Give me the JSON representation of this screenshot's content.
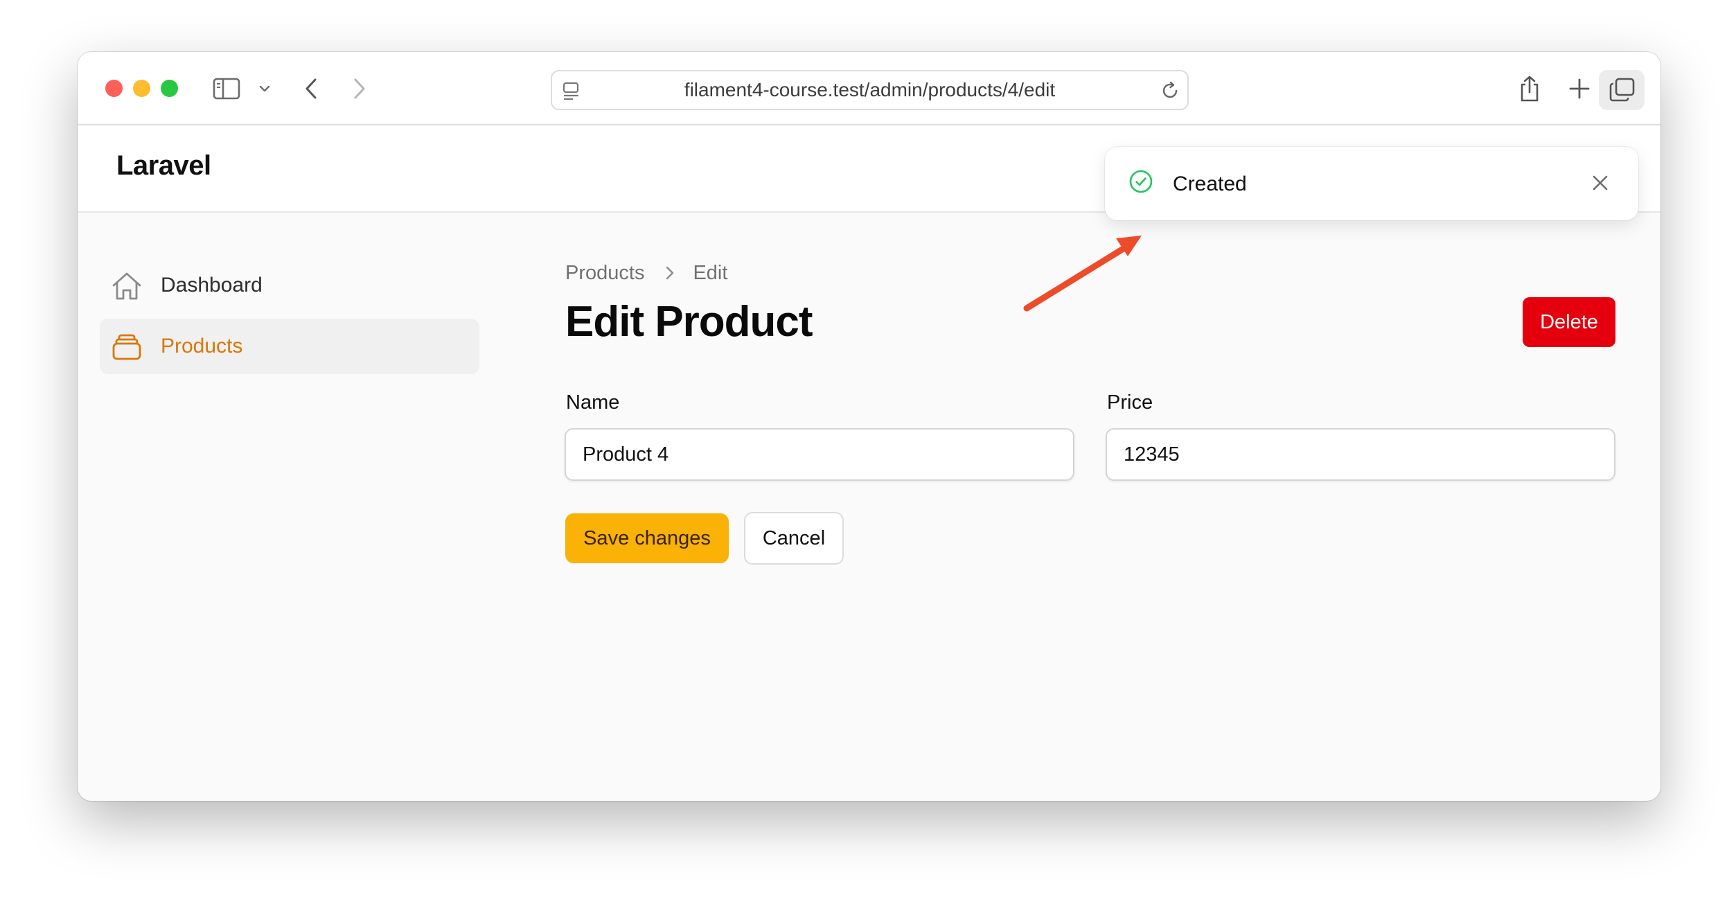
{
  "browser": {
    "url": "filament4-course.test/admin/products/4/edit",
    "icons": [
      "sidebar-toggle-icon",
      "chevron-down-icon",
      "back-arrow-icon",
      "forward-arrow-icon",
      "site-info-icon",
      "reload-icon",
      "share-icon",
      "new-tab-icon",
      "tab-overview-icon"
    ]
  },
  "app": {
    "brand": "Laravel"
  },
  "sidebar": {
    "items": [
      {
        "label": "Dashboard",
        "icon": "home-icon",
        "active": false
      },
      {
        "label": "Products",
        "icon": "rectangle-stack-icon",
        "active": true
      }
    ]
  },
  "breadcrumb": {
    "items": [
      "Products",
      "Edit"
    ]
  },
  "page": {
    "title": "Edit Product",
    "delete_label": "Delete"
  },
  "form": {
    "name": {
      "label": "Name",
      "value": "Product 4"
    },
    "price": {
      "label": "Price",
      "value": "12345"
    },
    "save_label": "Save changes",
    "cancel_label": "Cancel"
  },
  "notification": {
    "title": "Created",
    "status": "success"
  },
  "colors": {
    "primary": "#f9b205",
    "active_nav": "#d97706",
    "danger": "#e5000e",
    "success": "#22c55e",
    "annotation_arrow": "#ee4b2b"
  }
}
